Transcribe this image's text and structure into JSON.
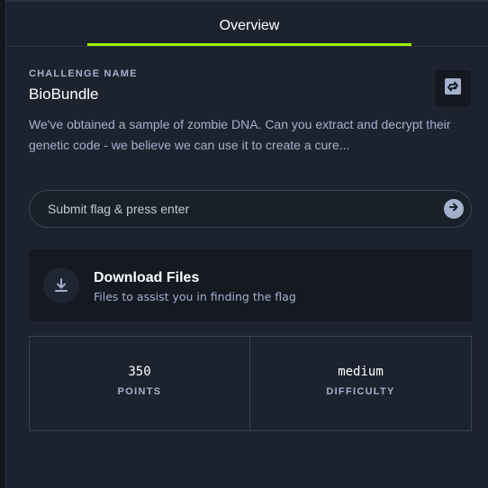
{
  "tabs": {
    "overview_label": "Overview"
  },
  "challenge": {
    "section_label": "CHALLENGE NAME",
    "name": "BioBundle",
    "description": "We've obtained a sample of zombie DNA. Can you extract and decrypt their genetic code - we believe we can use it to create a cure..."
  },
  "flag": {
    "placeholder": "Submit flag & press enter"
  },
  "download": {
    "title": "Download Files",
    "subtitle": "Files to assist you in finding the flag"
  },
  "stats": {
    "points_value": "350",
    "points_label": "POINTS",
    "difficulty_value": "medium",
    "difficulty_label": "DIFFICULTY"
  },
  "icons": {
    "swap": "swap-arrows-icon",
    "submit": "arrow-right-icon",
    "download": "download-icon"
  },
  "colors": {
    "accent": "#9fef00",
    "panel": "#1d232e",
    "muted_text": "#a4b1cd"
  }
}
